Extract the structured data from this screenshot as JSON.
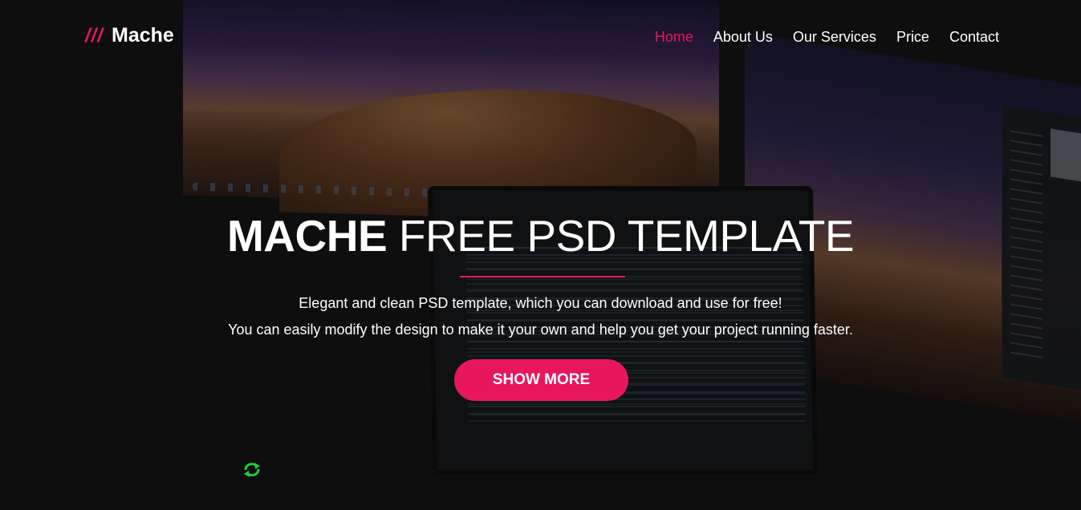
{
  "brand": {
    "slashes": "///",
    "name": "Mache"
  },
  "nav": [
    {
      "label": "Home",
      "active": true
    },
    {
      "label": "About Us",
      "active": false
    },
    {
      "label": "Our Services",
      "active": false
    },
    {
      "label": "Price",
      "active": false
    },
    {
      "label": "Contact",
      "active": false
    }
  ],
  "hero": {
    "title_strong": "MACHE",
    "title_light": "FREE PSD TEMPLATE",
    "line1": "Elegant and clean PSD template, which you can download and use for free!",
    "line2": "You can easily modify the design to make it your own and help you get your project running faster.",
    "button": "SHOW MORE"
  },
  "colors": {
    "accent": "#e8175d",
    "background": "#141414",
    "text": "#ffffff"
  },
  "icons": {
    "floating": "refresh-arrows-icon"
  }
}
